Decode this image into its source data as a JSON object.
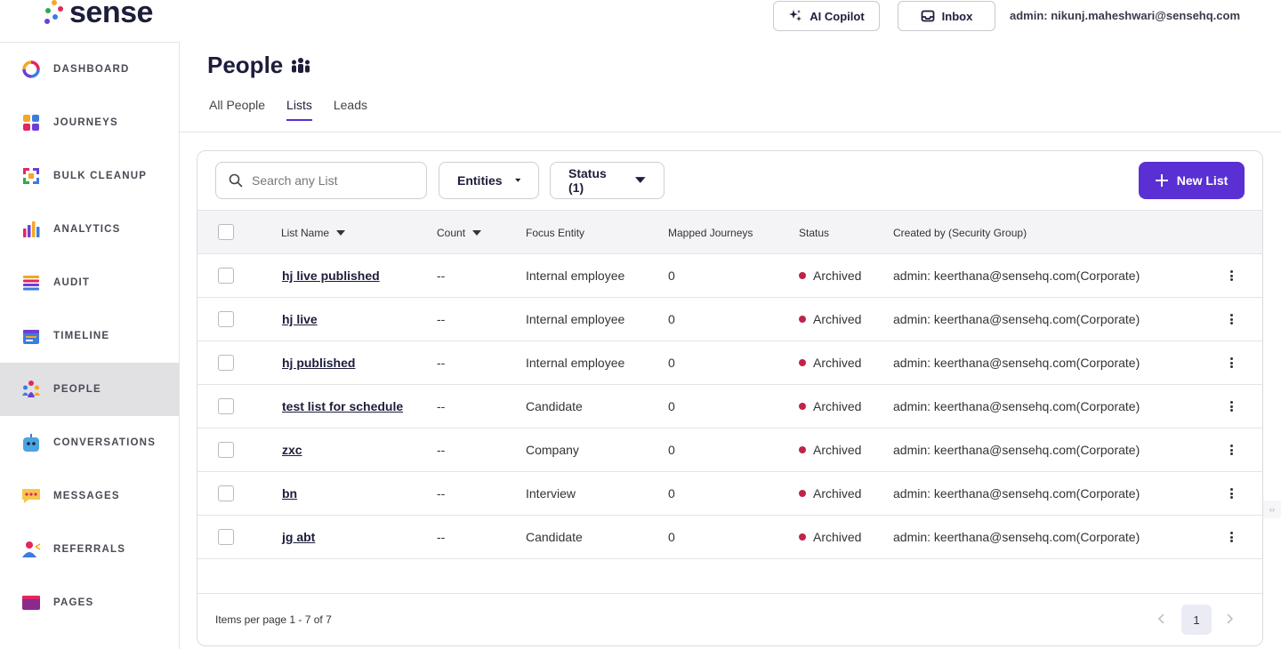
{
  "brand": {
    "name": "sense",
    "dot_colors": [
      "#f5a623",
      "#e2275d",
      "#2fa84f",
      "#3d7be0",
      "#6b3fd6"
    ]
  },
  "header": {
    "copilot_label": "AI Copilot",
    "inbox_label": "Inbox",
    "admin_text": "admin: nikunj.maheshwari@sensehq.com"
  },
  "sidebar": {
    "items": [
      {
        "label": "DASHBOARD",
        "icon": "dashboard-ring-icon"
      },
      {
        "label": "JOURNEYS",
        "icon": "journeys-grid-icon"
      },
      {
        "label": "BULK CLEANUP",
        "icon": "bulk-cleanup-arrows-icon"
      },
      {
        "label": "ANALYTICS",
        "icon": "analytics-bars-icon"
      },
      {
        "label": "AUDIT",
        "icon": "audit-list-icon"
      },
      {
        "label": "TIMELINE",
        "icon": "timeline-calendar-icon"
      },
      {
        "label": "PEOPLE",
        "icon": "people-icon",
        "active": true
      },
      {
        "label": "CONVERSATIONS",
        "icon": "conversations-bot-icon"
      },
      {
        "label": "MESSAGES",
        "icon": "messages-bubble-icon"
      },
      {
        "label": "REFERRALS",
        "icon": "referrals-person-icon"
      },
      {
        "label": "PAGES",
        "icon": "pages-window-icon"
      }
    ]
  },
  "page": {
    "title": "People",
    "tabs": [
      {
        "label": "All People",
        "active": false
      },
      {
        "label": "Lists",
        "active": true
      },
      {
        "label": "Leads",
        "active": false
      }
    ]
  },
  "toolbar": {
    "search_placeholder": "Search any List",
    "entities_label": "Entities",
    "status_label": "Status (1)",
    "new_list_label": "New List"
  },
  "table": {
    "columns": [
      "List Name",
      "Count",
      "Focus Entity",
      "Mapped Journeys",
      "Status",
      "Created by (Security Group)"
    ],
    "rows": [
      {
        "name": "hj live published",
        "count": "--",
        "entity": "Internal employee",
        "journeys": "0",
        "status": "Archived",
        "created_by": "admin: keerthana@sensehq.com(Corporate)"
      },
      {
        "name": "hj live",
        "count": "--",
        "entity": "Internal employee",
        "journeys": "0",
        "status": "Archived",
        "created_by": "admin: keerthana@sensehq.com(Corporate)"
      },
      {
        "name": "hj published",
        "count": "--",
        "entity": "Internal employee",
        "journeys": "0",
        "status": "Archived",
        "created_by": "admin: keerthana@sensehq.com(Corporate)"
      },
      {
        "name": "test list for schedule",
        "count": "--",
        "entity": "Candidate",
        "journeys": "0",
        "status": "Archived",
        "created_by": "admin: keerthana@sensehq.com(Corporate)"
      },
      {
        "name": "zxc",
        "count": "--",
        "entity": "Company",
        "journeys": "0",
        "status": "Archived",
        "created_by": "admin: keerthana@sensehq.com(Corporate)"
      },
      {
        "name": "bn",
        "count": "--",
        "entity": "Interview",
        "journeys": "0",
        "status": "Archived",
        "created_by": "admin: keerthana@sensehq.com(Corporate)"
      },
      {
        "name": "jg abt",
        "count": "--",
        "entity": "Candidate",
        "journeys": "0",
        "status": "Archived",
        "created_by": "admin: keerthana@sensehq.com(Corporate)"
      }
    ],
    "status_color": "#c0224b"
  },
  "pagination": {
    "items_text": "Items per page 1 - 7 of 7",
    "current_page": "1"
  },
  "colors": {
    "accent": "#5a2fd3",
    "active_nav_bg": "#e1e1e4"
  }
}
